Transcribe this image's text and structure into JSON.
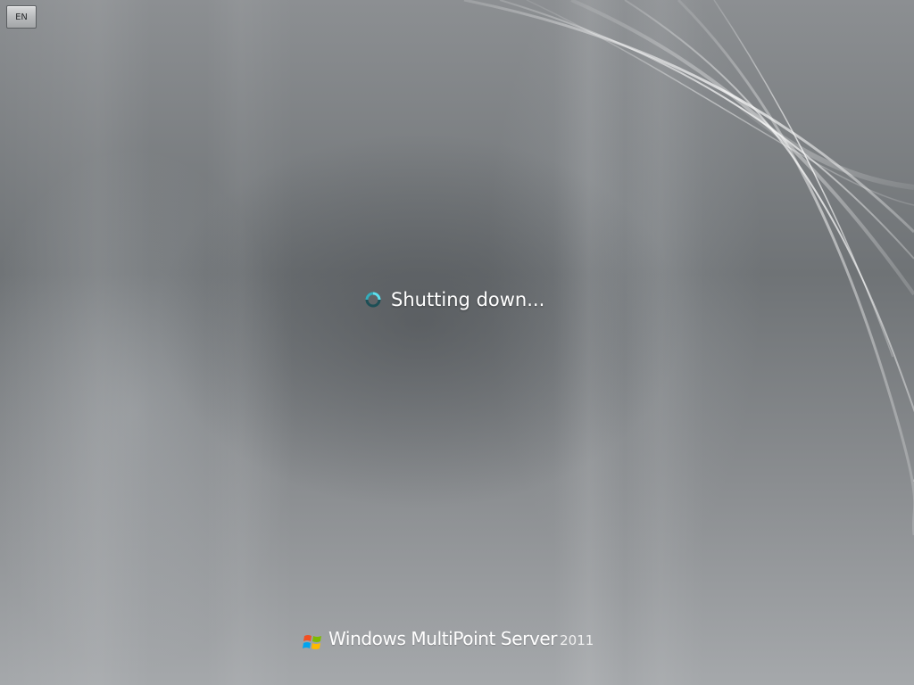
{
  "language_button": {
    "label": "EN"
  },
  "status": {
    "text": "Shutting down...",
    "icon": "spinner-icon"
  },
  "branding": {
    "logo_icon": "windows-logo-icon",
    "product_name": "Windows MultiPoint Server",
    "year": "2011"
  },
  "colors": {
    "background": "#8e9194",
    "text": "#ffffff",
    "spinner_accent": "#3cc4d4"
  }
}
